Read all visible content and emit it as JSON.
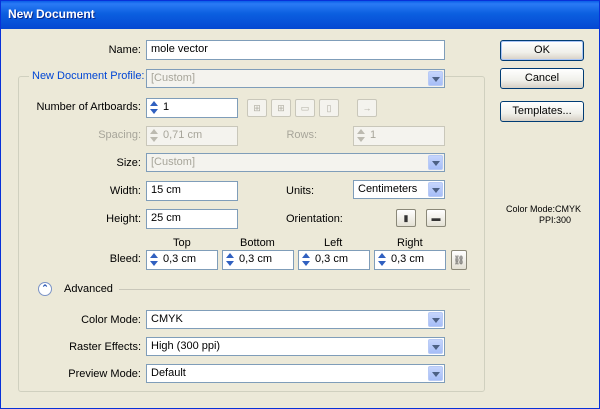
{
  "window": {
    "title": "New Document"
  },
  "name": {
    "label": "Name:",
    "value": "mole vector"
  },
  "profile": {
    "label": "New Document Profile:",
    "value": "[Custom]"
  },
  "artboards": {
    "label": "Number of Artboards:",
    "value": "1"
  },
  "spacing": {
    "label": "Spacing:",
    "value": "0,71 cm"
  },
  "rows": {
    "label": "Rows:",
    "value": "1"
  },
  "size": {
    "label": "Size:",
    "value": "[Custom]"
  },
  "width": {
    "label": "Width:",
    "value": "15 cm"
  },
  "height": {
    "label": "Height:",
    "value": "25 cm"
  },
  "units": {
    "label": "Units:",
    "value": "Centimeters"
  },
  "orientation": {
    "label": "Orientation:"
  },
  "bleed": {
    "label": "Bleed:",
    "top": {
      "label": "Top",
      "value": "0,3 cm"
    },
    "bottom": {
      "label": "Bottom",
      "value": "0,3 cm"
    },
    "left": {
      "label": "Left",
      "value": "0,3 cm"
    },
    "right": {
      "label": "Right",
      "value": "0,3 cm"
    }
  },
  "advanced": {
    "label": "Advanced",
    "color_mode": {
      "label": "Color Mode:",
      "value": "CMYK"
    },
    "raster_effects": {
      "label": "Raster Effects:",
      "value": "High (300 ppi)"
    },
    "preview_mode": {
      "label": "Preview Mode:",
      "value": "Default"
    }
  },
  "buttons": {
    "ok": "OK",
    "cancel": "Cancel",
    "templates": "Templates..."
  },
  "summary": {
    "color_mode": "Color Mode:CMYK",
    "ppi": "PPI:300"
  },
  "icons": {
    "artboard_layouts": [
      "grid-by-row-icon",
      "grid-by-column-icon",
      "arrange-by-row-icon",
      "arrange-by-column-icon",
      "right-to-left-icon"
    ],
    "orientation": [
      "portrait-icon",
      "landscape-icon"
    ],
    "bleed_link": "chain-link-icon",
    "advanced_toggle": "collapse-up-icon"
  },
  "colors": {
    "title_bar": "#0a5ee8",
    "dialog_bg": "#ece9d8",
    "legend_text": "#0046d5"
  }
}
